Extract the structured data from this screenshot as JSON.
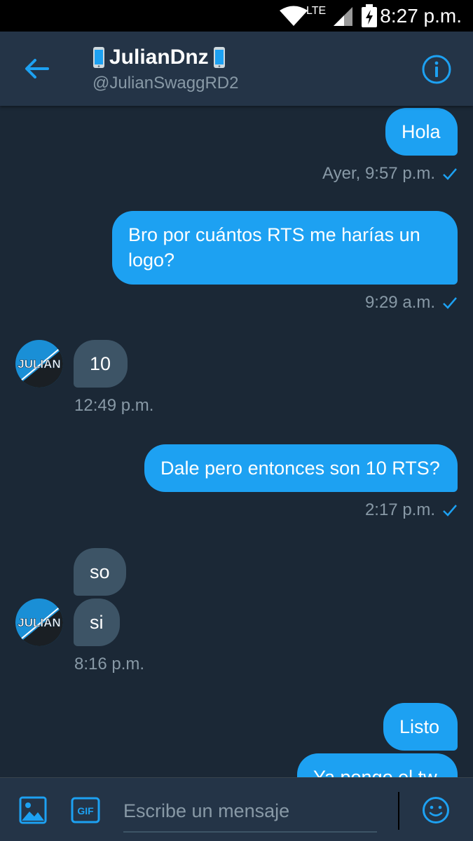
{
  "status_bar": {
    "network": "LTE",
    "time": "8:27 p.m."
  },
  "header": {
    "name": "JulianDnz",
    "handle": "@JulianSwaggRD2",
    "icons": {
      "back": "back-arrow-icon",
      "info": "info-icon",
      "emoji": "mobile-phone-emoji"
    }
  },
  "messages": [
    {
      "direction": "out",
      "text": "Hola"
    },
    {
      "direction": "out",
      "text": "Bro por cuántos RTS me harías un logo?"
    },
    {
      "direction": "in",
      "text": "10"
    },
    {
      "direction": "out",
      "text": "Dale pero entonces son 10 RTS?"
    },
    {
      "direction": "in",
      "text": "so"
    },
    {
      "direction": "in",
      "text": "si"
    },
    {
      "direction": "out",
      "text": "Listo"
    },
    {
      "direction": "out",
      "text": "Ya pongo el tw"
    }
  ],
  "timestamps": {
    "t1": "Ayer, 9:57 p.m.",
    "t2": "9:29 a.m.",
    "t3": "12:49 p.m.",
    "t4": "2:17 p.m.",
    "t5": "8:16 p.m."
  },
  "avatar": {
    "text": "JULIAN"
  },
  "composer": {
    "placeholder": "Escribe un mensaje",
    "gif_label": "GIF",
    "icons": {
      "image": "image-icon",
      "gif": "gif-icon",
      "emoji": "emoji-icon"
    }
  },
  "colors": {
    "accent": "#1da1f2",
    "background": "#1b2836",
    "header": "#243447",
    "incoming_bubble": "#3d5466",
    "secondary_text": "#8899a6"
  }
}
